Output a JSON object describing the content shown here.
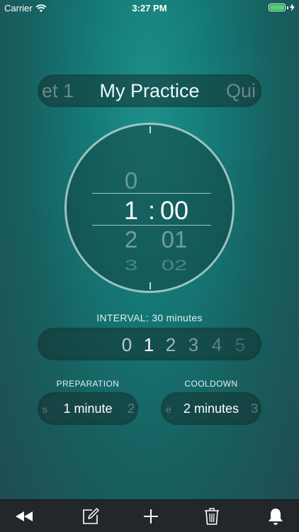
{
  "status_bar": {
    "carrier": "Carrier",
    "time": "3:27 PM",
    "battery_color": "#4cd964"
  },
  "practice_picker": {
    "previous": "et 1",
    "current": "My Practice",
    "next": "Qui"
  },
  "time_picker": {
    "hours": [
      "0",
      "1",
      "2",
      "3"
    ],
    "separator": ":",
    "minutes": [
      "00",
      "01",
      "02"
    ]
  },
  "interval": {
    "label": "INTERVAL: 30 minutes",
    "values": [
      "0",
      "1",
      "2",
      "3",
      "4",
      "5"
    ]
  },
  "preparation": {
    "label": "PREPARATION",
    "previous": "s",
    "current": "1 minute",
    "next": "2"
  },
  "cooldown": {
    "label": "COOLDOWN",
    "previous": "e",
    "current": "2 minutes",
    "next": "3"
  },
  "toolbar": {
    "icons": [
      "rewind-icon",
      "edit-icon",
      "add-icon",
      "trash-icon",
      "bell-icon"
    ]
  },
  "colors": {
    "background_top": "#1e8f8a",
    "background_bottom": "#214a50",
    "toolbar": "#23272a"
  }
}
